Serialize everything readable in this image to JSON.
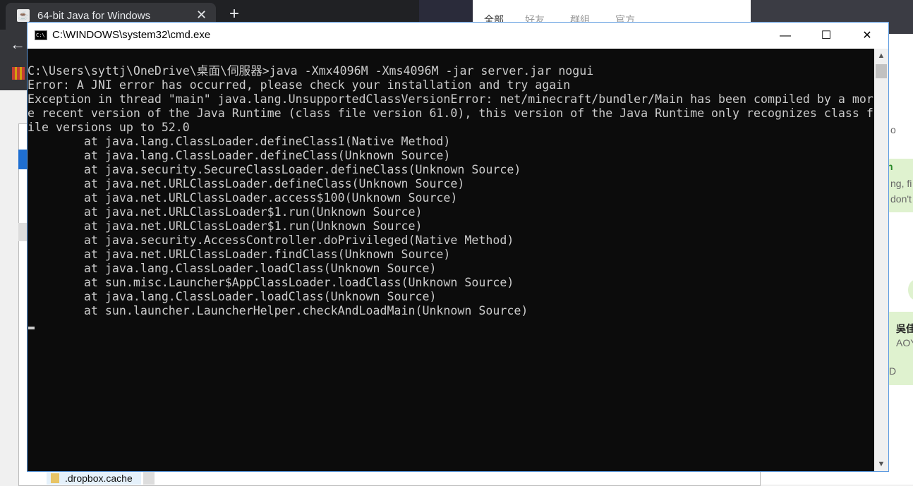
{
  "browser": {
    "tab_title": "64-bit Java for Windows",
    "tab_close": "✕",
    "new_tab": "+",
    "back": "←"
  },
  "right_pane": {
    "tabs": [
      "全部",
      "好友",
      "群組",
      "官方"
    ],
    "snip1": "n",
    "snip2": "ng, fi",
    "snip3": "don't",
    "snip4": "吳佳",
    "snip5": "AOY",
    "snip6": "o",
    "snip7": "D"
  },
  "explorer": {
    "folder_name": ".dropbox.cache"
  },
  "cmd": {
    "title": "C:\\WINDOWS\\system32\\cmd.exe",
    "icon_text": "C:\\",
    "minimize": "—",
    "maximize": "☐",
    "close": "✕",
    "output": "C:\\Users\\syttj\\OneDrive\\桌面\\伺服器>java -Xmx4096M -Xms4096M -jar server.jar nogui\nError: A JNI error has occurred, please check your installation and try again\nException in thread \"main\" java.lang.UnsupportedClassVersionError: net/minecraft/bundler/Main has been compiled by a mor\ne recent version of the Java Runtime (class file version 61.0), this version of the Java Runtime only recognizes class f\nile versions up to 52.0\n        at java.lang.ClassLoader.defineClass1(Native Method)\n        at java.lang.ClassLoader.defineClass(Unknown Source)\n        at java.security.SecureClassLoader.defineClass(Unknown Source)\n        at java.net.URLClassLoader.defineClass(Unknown Source)\n        at java.net.URLClassLoader.access$100(Unknown Source)\n        at java.net.URLClassLoader$1.run(Unknown Source)\n        at java.net.URLClassLoader$1.run(Unknown Source)\n        at java.security.AccessController.doPrivileged(Native Method)\n        at java.net.URLClassLoader.findClass(Unknown Source)\n        at java.lang.ClassLoader.loadClass(Unknown Source)\n        at sun.misc.Launcher$AppClassLoader.loadClass(Unknown Source)\n        at java.lang.ClassLoader.loadClass(Unknown Source)\n        at sun.launcher.LauncherHelper.checkAndLoadMain(Unknown Source)"
  },
  "scrollbar": {
    "up": "▲",
    "down": "▼"
  }
}
